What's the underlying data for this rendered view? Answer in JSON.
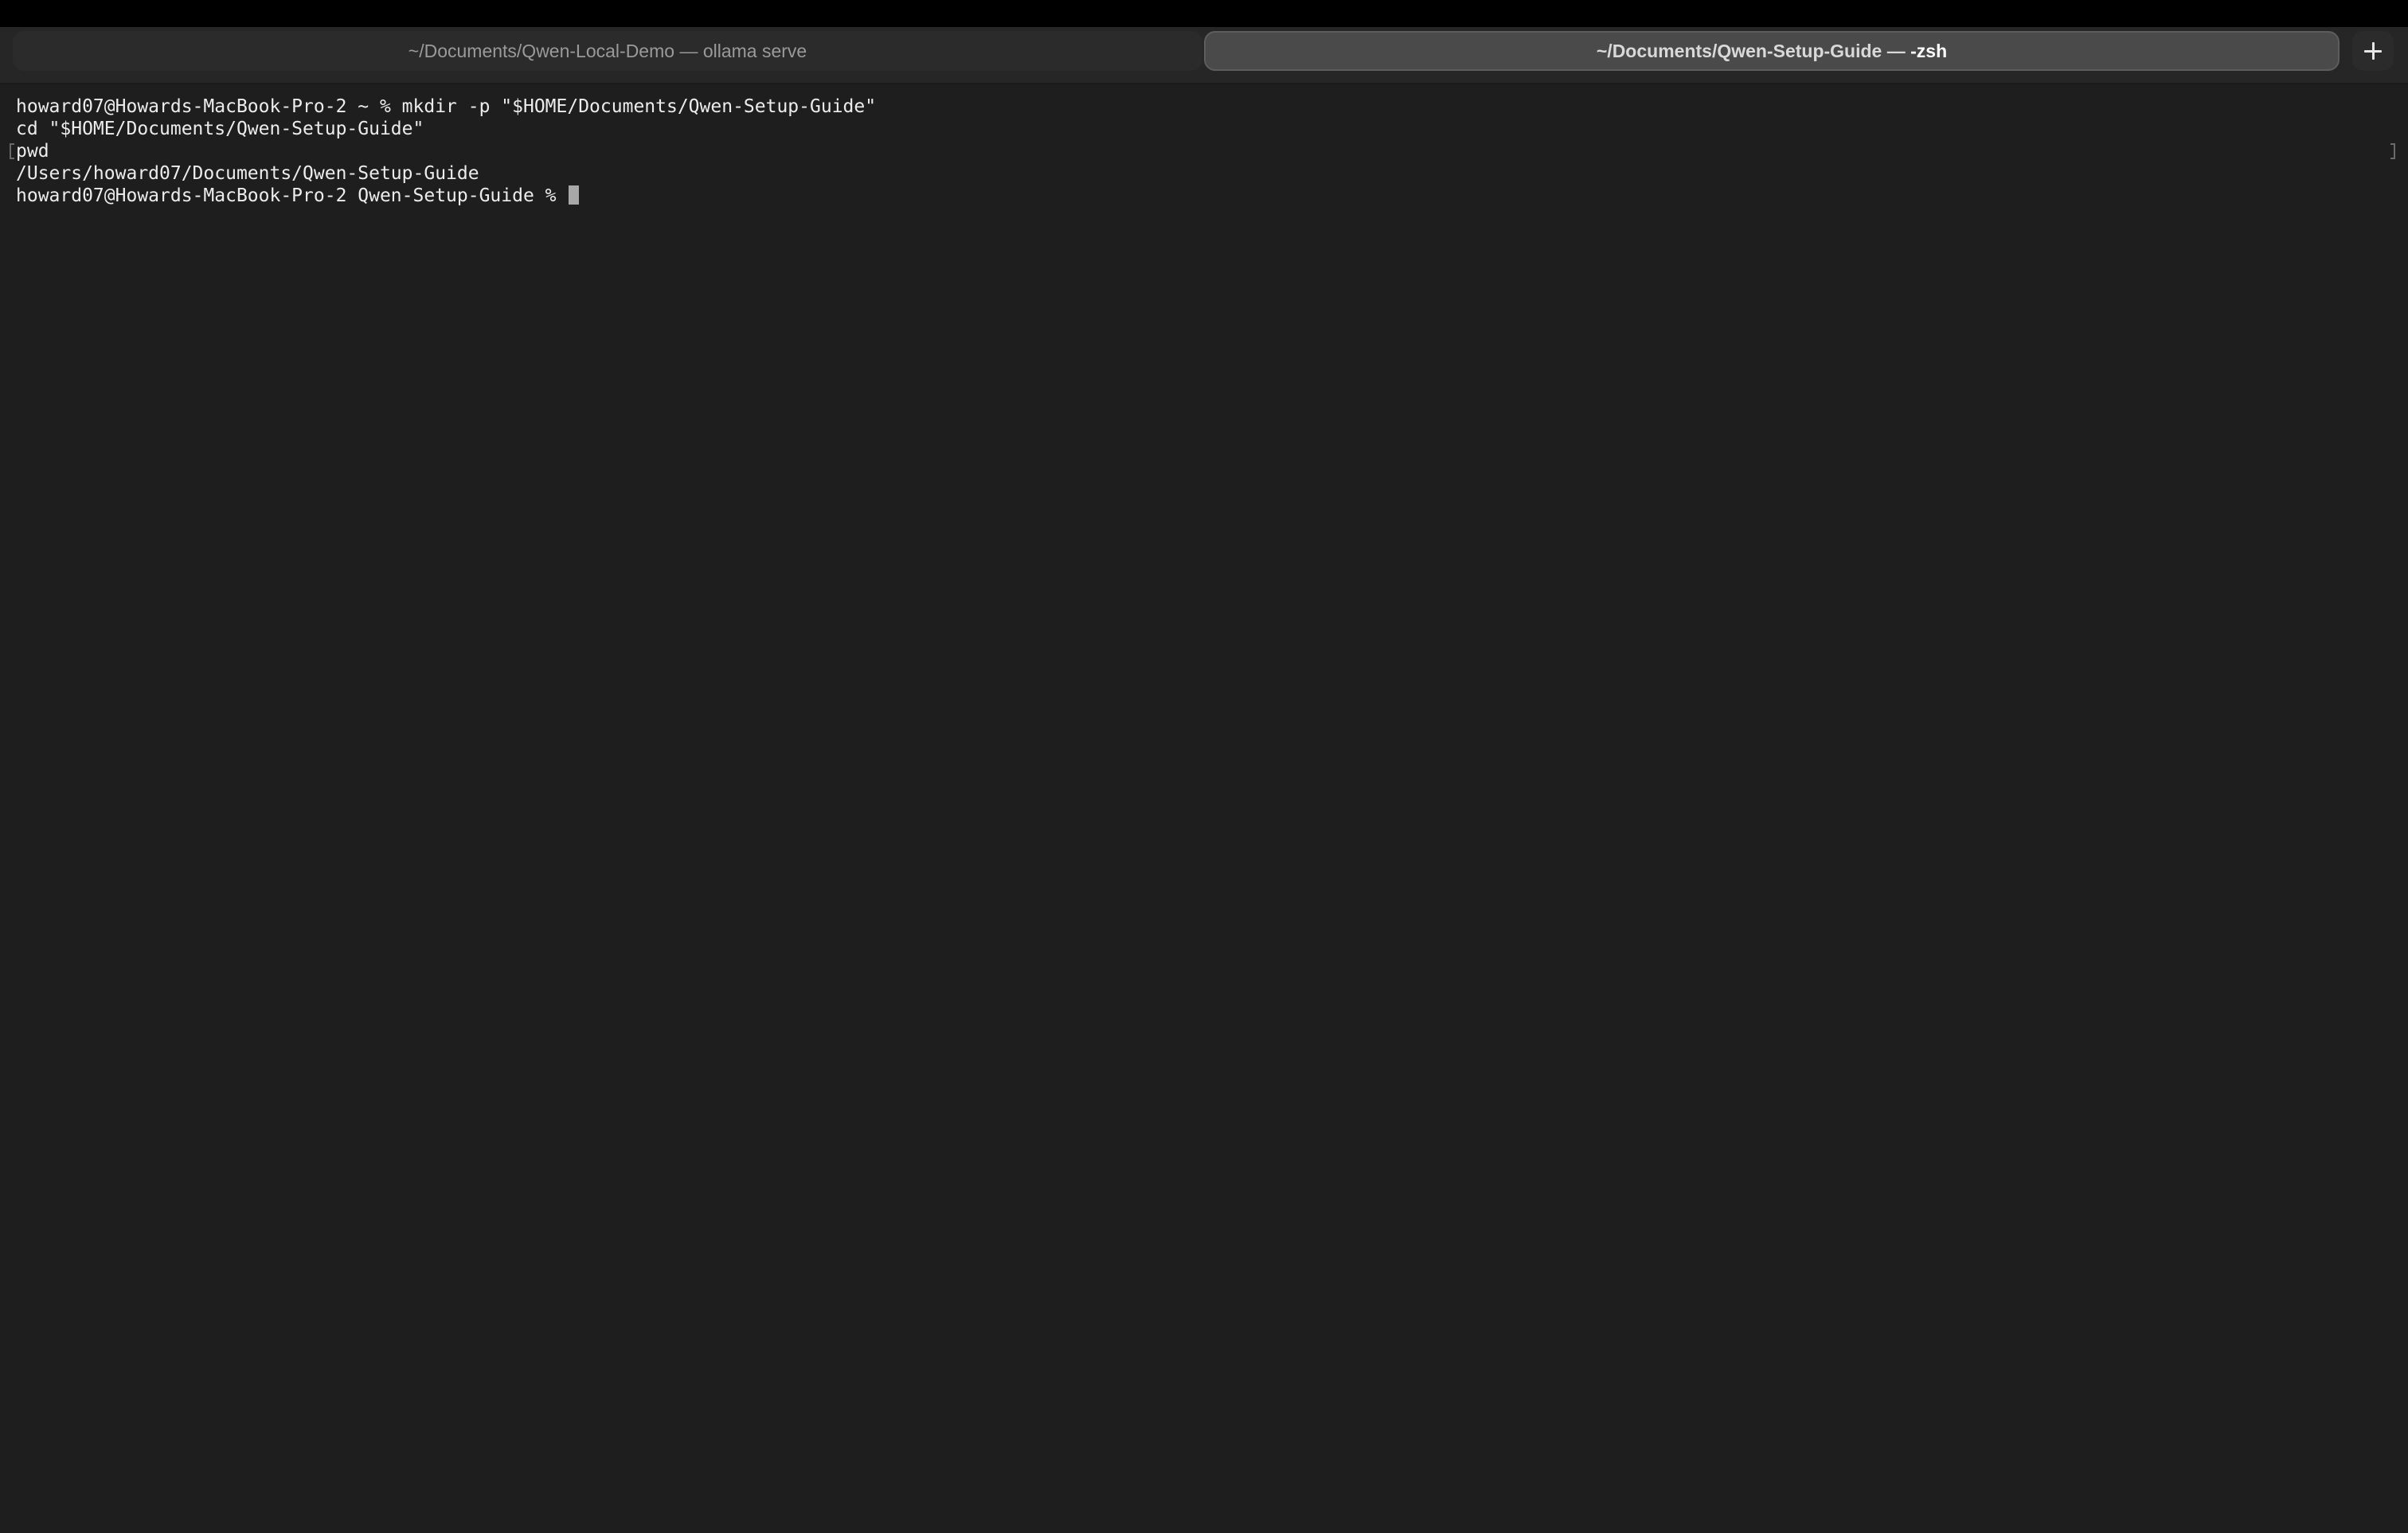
{
  "tabs": [
    {
      "path": "~/Documents/Qwen-Local-Demo",
      "separator": "—",
      "process": "ollama serve",
      "active": false
    },
    {
      "path": "~/Documents/Qwen-Setup-Guide",
      "separator": "—",
      "process": "-zsh",
      "active": true
    }
  ],
  "new_tab_icon": "plus-icon",
  "terminal": {
    "lines": [
      "howard07@Howards-MacBook-Pro-2 ~ % mkdir -p \"$HOME/Documents/Qwen-Setup-Guide\"",
      "cd \"$HOME/Documents/Qwen-Setup-Guide\"",
      "pwd",
      "/Users/howard07/Documents/Qwen-Setup-Guide",
      "howard07@Howards-MacBook-Pro-2 Qwen-Setup-Guide % "
    ]
  },
  "colors": {
    "background": "#1e1e1e",
    "tab_bar": "#262626",
    "active_tab": "#4a4a4a",
    "text": "#ececec",
    "cursor": "#a8a8a8"
  }
}
